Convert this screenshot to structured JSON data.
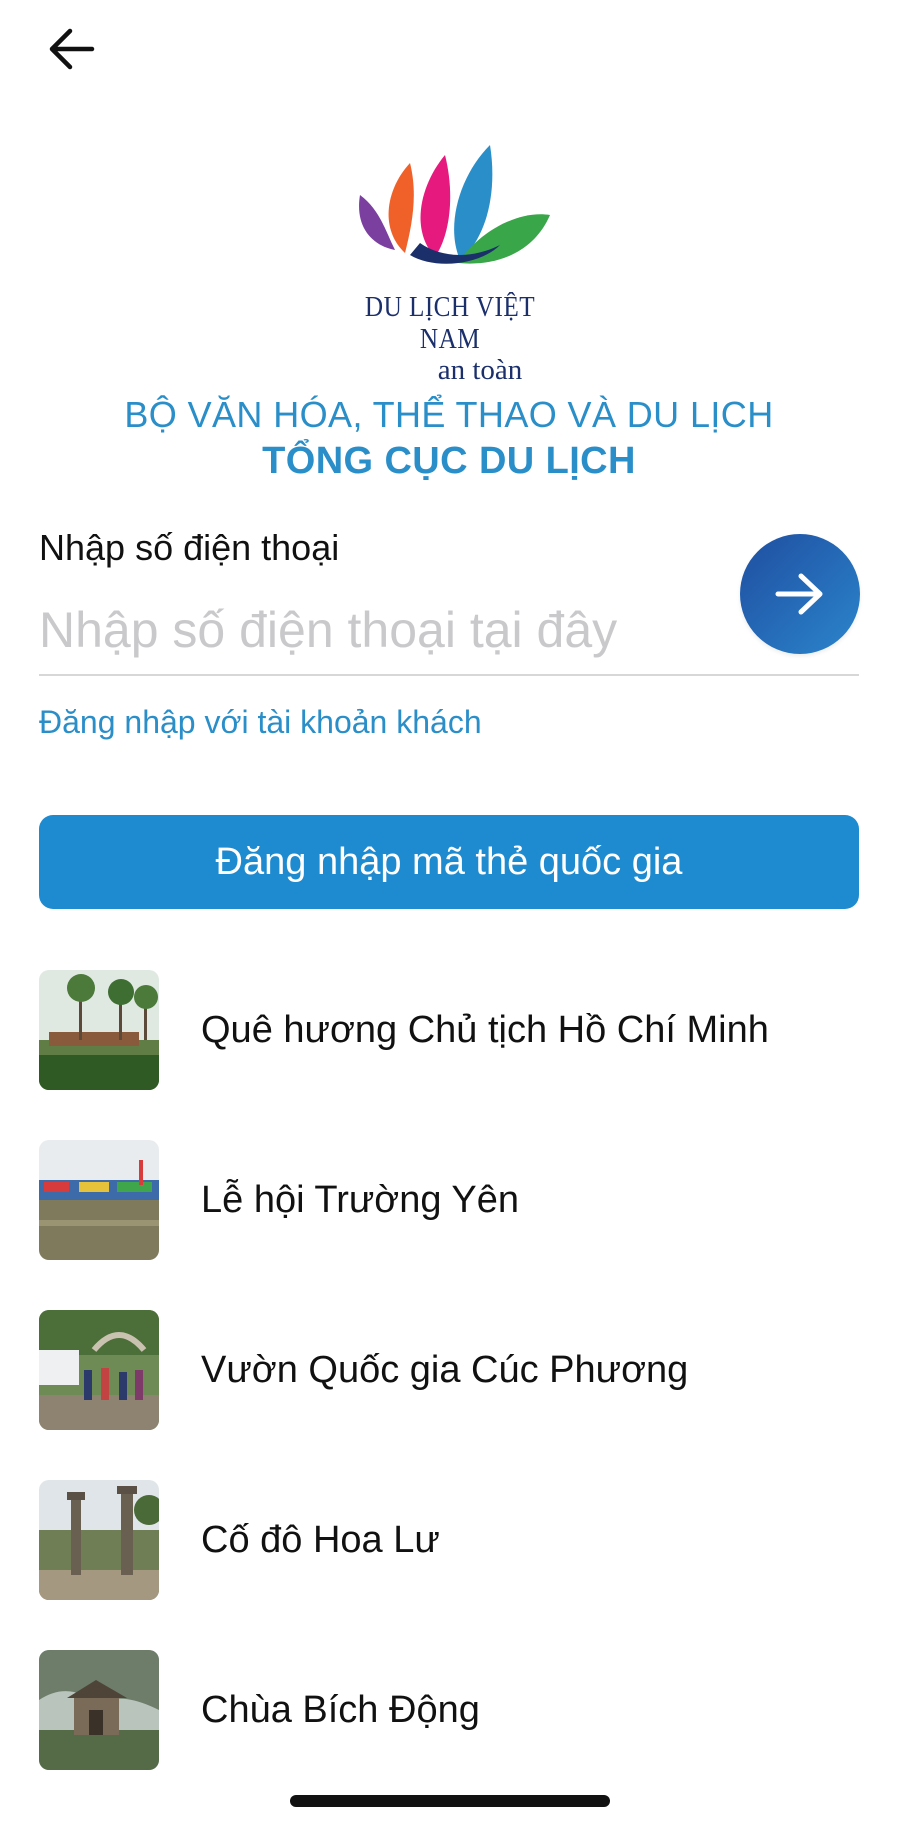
{
  "header": {
    "back_icon": "arrow-left-icon"
  },
  "logo": {
    "line1": "DU LỊCH VIỆT NAM",
    "line2": "an toàn",
    "petal_colors": [
      "#7b3fa0",
      "#f0612a",
      "#e6197e",
      "#2a8ec9",
      "#3aa64a"
    ]
  },
  "organization": {
    "ministry": "BỘ VĂN HÓA, THỂ THAO VÀ DU LỊCH",
    "department": "TỔNG CỤC DU LỊCH"
  },
  "login": {
    "phone_label": "Nhập số điện thoại",
    "phone_placeholder": "Nhập số điện thoại tại đây",
    "phone_value": "",
    "submit_icon": "arrow-right-icon",
    "guest_link": "Đăng nhập với tài khoản khách",
    "national_button": "Đăng nhập mã thẻ quốc gia"
  },
  "destinations": [
    {
      "label": "Quê hương Chủ tịch Hồ Chí Minh",
      "thumb": "palm-village-photo"
    },
    {
      "label": "Lễ hội Trường Yên",
      "thumb": "festival-river-photo"
    },
    {
      "label": "Vườn Quốc gia Cúc Phương",
      "thumb": "park-gate-photo"
    },
    {
      "label": "Cố đô Hoa Lư",
      "thumb": "ancient-capital-photo"
    },
    {
      "label": "Chùa Bích Động",
      "thumb": "pagoda-cliff-photo"
    }
  ],
  "colors": {
    "accent": "#2a8ec9",
    "button": "#1e8bd0",
    "submit_gradient_start": "#1f4ea0",
    "submit_gradient_end": "#2b85cc"
  }
}
